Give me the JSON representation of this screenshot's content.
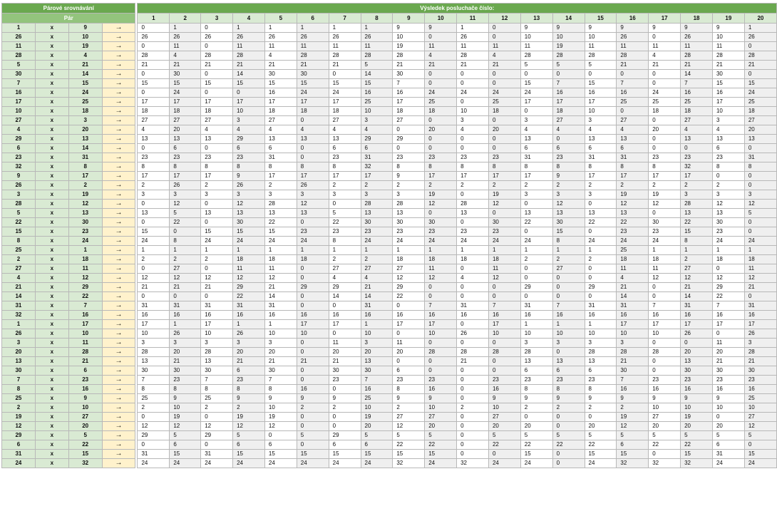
{
  "header": {
    "pair_group": "Párové srovnávání",
    "pair": "Pár",
    "result_group": "Výsledek posluchače číslo:"
  },
  "listeners": [
    "1",
    "2",
    "3",
    "4",
    "5",
    "6",
    "7",
    "8",
    "9",
    "10",
    "11",
    "12",
    "13",
    "14",
    "15",
    "16",
    "17",
    "18",
    "19",
    "20"
  ],
  "rows": [
    {
      "a": "1",
      "b": "9",
      "vals": [
        "0",
        "1",
        "0",
        "1",
        "1",
        "1",
        "1",
        "1",
        "9",
        "9",
        "1",
        "0",
        "9",
        "9",
        "9",
        "9",
        "9",
        "9",
        "9",
        "1"
      ]
    },
    {
      "a": "26",
      "b": "10",
      "vals": [
        "26",
        "26",
        "26",
        "26",
        "26",
        "26",
        "26",
        "26",
        "10",
        "0",
        "26",
        "0",
        "10",
        "10",
        "10",
        "26",
        "0",
        "26",
        "10",
        "26"
      ]
    },
    {
      "a": "11",
      "b": "19",
      "vals": [
        "0",
        "11",
        "0",
        "11",
        "11",
        "11",
        "11",
        "11",
        "19",
        "11",
        "11",
        "11",
        "11",
        "19",
        "11",
        "11",
        "11",
        "11",
        "11",
        "0"
      ]
    },
    {
      "a": "28",
      "b": "4",
      "vals": [
        "28",
        "4",
        "28",
        "28",
        "4",
        "28",
        "28",
        "28",
        "28",
        "4",
        "28",
        "4",
        "28",
        "28",
        "28",
        "28",
        "4",
        "28",
        "28",
        "28"
      ]
    },
    {
      "a": "5",
      "b": "21",
      "vals": [
        "21",
        "21",
        "21",
        "21",
        "21",
        "21",
        "21",
        "5",
        "21",
        "21",
        "21",
        "21",
        "5",
        "5",
        "5",
        "21",
        "21",
        "21",
        "21",
        "21"
      ]
    },
    {
      "a": "30",
      "b": "14",
      "vals": [
        "0",
        "30",
        "0",
        "14",
        "30",
        "30",
        "0",
        "14",
        "30",
        "0",
        "0",
        "0",
        "0",
        "0",
        "0",
        "0",
        "0",
        "14",
        "30",
        "0"
      ]
    },
    {
      "a": "7",
      "b": "15",
      "vals": [
        "15",
        "15",
        "15",
        "15",
        "15",
        "15",
        "15",
        "15",
        "7",
        "0",
        "0",
        "0",
        "15",
        "7",
        "15",
        "7",
        "0",
        "7",
        "15",
        "15"
      ]
    },
    {
      "a": "16",
      "b": "24",
      "vals": [
        "0",
        "24",
        "0",
        "0",
        "16",
        "24",
        "24",
        "16",
        "16",
        "24",
        "24",
        "24",
        "24",
        "16",
        "16",
        "16",
        "24",
        "16",
        "16",
        "24"
      ]
    },
    {
      "a": "17",
      "b": "25",
      "vals": [
        "17",
        "17",
        "17",
        "17",
        "17",
        "17",
        "17",
        "25",
        "17",
        "25",
        "0",
        "25",
        "17",
        "17",
        "17",
        "25",
        "25",
        "25",
        "17",
        "25"
      ]
    },
    {
      "a": "10",
      "b": "18",
      "vals": [
        "18",
        "18",
        "18",
        "10",
        "18",
        "18",
        "18",
        "10",
        "18",
        "18",
        "10",
        "18",
        "0",
        "18",
        "10",
        "0",
        "18",
        "18",
        "10",
        "18"
      ]
    },
    {
      "a": "27",
      "b": "3",
      "vals": [
        "27",
        "27",
        "27",
        "3",
        "27",
        "0",
        "27",
        "3",
        "27",
        "0",
        "3",
        "0",
        "3",
        "27",
        "3",
        "27",
        "0",
        "27",
        "3",
        "27"
      ]
    },
    {
      "a": "4",
      "b": "20",
      "vals": [
        "4",
        "20",
        "4",
        "4",
        "4",
        "4",
        "4",
        "4",
        "0",
        "20",
        "4",
        "20",
        "4",
        "4",
        "4",
        "4",
        "20",
        "4",
        "4",
        "20"
      ]
    },
    {
      "a": "29",
      "b": "13",
      "vals": [
        "13",
        "13",
        "13",
        "29",
        "13",
        "13",
        "13",
        "29",
        "29",
        "0",
        "0",
        "0",
        "13",
        "0",
        "13",
        "13",
        "0",
        "13",
        "13",
        "13"
      ]
    },
    {
      "a": "6",
      "b": "14",
      "vals": [
        "0",
        "6",
        "0",
        "6",
        "6",
        "0",
        "6",
        "6",
        "0",
        "0",
        "0",
        "0",
        "6",
        "6",
        "6",
        "6",
        "0",
        "0",
        "6",
        "0"
      ]
    },
    {
      "a": "23",
      "b": "31",
      "vals": [
        "23",
        "23",
        "23",
        "23",
        "31",
        "0",
        "23",
        "31",
        "23",
        "23",
        "23",
        "23",
        "31",
        "23",
        "31",
        "31",
        "23",
        "23",
        "23",
        "31"
      ]
    },
    {
      "a": "32",
      "b": "8",
      "vals": [
        "8",
        "8",
        "8",
        "8",
        "8",
        "8",
        "8",
        "32",
        "8",
        "8",
        "8",
        "8",
        "8",
        "8",
        "8",
        "8",
        "8",
        "32",
        "8",
        "8"
      ]
    },
    {
      "a": "9",
      "b": "17",
      "vals": [
        "17",
        "17",
        "17",
        "9",
        "17",
        "17",
        "17",
        "17",
        "9",
        "17",
        "17",
        "17",
        "17",
        "9",
        "17",
        "17",
        "17",
        "17",
        "0",
        "0"
      ]
    },
    {
      "a": "26",
      "b": "2",
      "vals": [
        "2",
        "26",
        "2",
        "26",
        "2",
        "26",
        "2",
        "2",
        "2",
        "2",
        "2",
        "2",
        "2",
        "2",
        "2",
        "2",
        "2",
        "2",
        "2",
        "0"
      ]
    },
    {
      "a": "3",
      "b": "19",
      "vals": [
        "3",
        "3",
        "3",
        "3",
        "3",
        "3",
        "3",
        "3",
        "3",
        "19",
        "0",
        "19",
        "3",
        "3",
        "3",
        "19",
        "19",
        "3",
        "3",
        "3"
      ]
    },
    {
      "a": "28",
      "b": "12",
      "vals": [
        "0",
        "12",
        "0",
        "12",
        "28",
        "12",
        "0",
        "28",
        "28",
        "12",
        "28",
        "12",
        "0",
        "12",
        "0",
        "12",
        "12",
        "28",
        "12",
        "12"
      ]
    },
    {
      "a": "5",
      "b": "13",
      "vals": [
        "13",
        "5",
        "13",
        "13",
        "13",
        "13",
        "5",
        "13",
        "13",
        "0",
        "13",
        "0",
        "13",
        "13",
        "13",
        "13",
        "0",
        "13",
        "13",
        "5"
      ]
    },
    {
      "a": "22",
      "b": "30",
      "vals": [
        "0",
        "22",
        "0",
        "30",
        "22",
        "0",
        "22",
        "30",
        "30",
        "30",
        "0",
        "30",
        "22",
        "30",
        "22",
        "22",
        "30",
        "22",
        "30",
        "0"
      ]
    },
    {
      "a": "15",
      "b": "23",
      "vals": [
        "15",
        "0",
        "15",
        "15",
        "15",
        "23",
        "23",
        "23",
        "23",
        "23",
        "23",
        "23",
        "0",
        "15",
        "0",
        "23",
        "23",
        "15",
        "23",
        "0"
      ]
    },
    {
      "a": "8",
      "b": "24",
      "vals": [
        "24",
        "8",
        "24",
        "24",
        "24",
        "24",
        "8",
        "24",
        "24",
        "24",
        "24",
        "24",
        "24",
        "8",
        "24",
        "24",
        "24",
        "8",
        "24",
        "24"
      ]
    },
    {
      "a": "25",
      "b": "1",
      "vals": [
        "1",
        "1",
        "1",
        "1",
        "1",
        "1",
        "1",
        "1",
        "1",
        "1",
        "1",
        "1",
        "1",
        "1",
        "1",
        "25",
        "1",
        "1",
        "1",
        "1"
      ]
    },
    {
      "a": "2",
      "b": "18",
      "vals": [
        "2",
        "2",
        "2",
        "18",
        "18",
        "18",
        "2",
        "2",
        "18",
        "18",
        "18",
        "18",
        "2",
        "2",
        "2",
        "18",
        "18",
        "2",
        "18",
        "18"
      ]
    },
    {
      "a": "27",
      "b": "11",
      "vals": [
        "0",
        "27",
        "0",
        "11",
        "11",
        "0",
        "27",
        "27",
        "27",
        "11",
        "0",
        "11",
        "0",
        "27",
        "0",
        "11",
        "11",
        "27",
        "0",
        "11"
      ]
    },
    {
      "a": "4",
      "b": "12",
      "vals": [
        "12",
        "12",
        "12",
        "12",
        "12",
        "0",
        "4",
        "4",
        "12",
        "12",
        "4",
        "12",
        "0",
        "0",
        "0",
        "4",
        "12",
        "12",
        "12",
        "12"
      ]
    },
    {
      "a": "21",
      "b": "29",
      "vals": [
        "21",
        "21",
        "21",
        "29",
        "21",
        "29",
        "29",
        "21",
        "29",
        "0",
        "0",
        "0",
        "29",
        "0",
        "29",
        "21",
        "0",
        "21",
        "29",
        "21"
      ]
    },
    {
      "a": "14",
      "b": "22",
      "vals": [
        "0",
        "0",
        "0",
        "22",
        "14",
        "0",
        "14",
        "14",
        "22",
        "0",
        "0",
        "0",
        "0",
        "0",
        "0",
        "14",
        "0",
        "14",
        "22",
        "0"
      ]
    },
    {
      "a": "31",
      "b": "7",
      "vals": [
        "31",
        "31",
        "31",
        "31",
        "31",
        "0",
        "0",
        "31",
        "0",
        "7",
        "31",
        "7",
        "31",
        "7",
        "31",
        "31",
        "7",
        "31",
        "7",
        "31"
      ]
    },
    {
      "a": "32",
      "b": "16",
      "vals": [
        "16",
        "16",
        "16",
        "16",
        "16",
        "16",
        "16",
        "16",
        "16",
        "16",
        "16",
        "16",
        "16",
        "16",
        "16",
        "16",
        "16",
        "16",
        "16",
        "16"
      ]
    },
    {
      "a": "1",
      "b": "17",
      "vals": [
        "17",
        "1",
        "17",
        "1",
        "1",
        "17",
        "17",
        "1",
        "17",
        "17",
        "0",
        "17",
        "1",
        "1",
        "1",
        "17",
        "17",
        "17",
        "17",
        "17"
      ]
    },
    {
      "a": "26",
      "b": "10",
      "vals": [
        "10",
        "26",
        "10",
        "26",
        "10",
        "10",
        "0",
        "10",
        "0",
        "10",
        "26",
        "10",
        "10",
        "10",
        "10",
        "10",
        "10",
        "26",
        "0",
        "26"
      ]
    },
    {
      "a": "3",
      "b": "11",
      "vals": [
        "3",
        "3",
        "3",
        "3",
        "3",
        "0",
        "11",
        "3",
        "11",
        "0",
        "0",
        "0",
        "3",
        "3",
        "3",
        "3",
        "0",
        "0",
        "11",
        "3"
      ]
    },
    {
      "a": "20",
      "b": "28",
      "vals": [
        "28",
        "20",
        "28",
        "20",
        "20",
        "0",
        "20",
        "20",
        "20",
        "28",
        "28",
        "28",
        "28",
        "0",
        "28",
        "28",
        "28",
        "20",
        "20",
        "28"
      ]
    },
    {
      "a": "13",
      "b": "21",
      "vals": [
        "13",
        "21",
        "13",
        "21",
        "21",
        "21",
        "21",
        "13",
        "0",
        "0",
        "21",
        "0",
        "13",
        "13",
        "13",
        "21",
        "0",
        "13",
        "21",
        "21"
      ]
    },
    {
      "a": "30",
      "b": "6",
      "vals": [
        "30",
        "30",
        "30",
        "6",
        "30",
        "0",
        "30",
        "30",
        "6",
        "0",
        "0",
        "0",
        "6",
        "6",
        "6",
        "30",
        "0",
        "30",
        "30",
        "30"
      ]
    },
    {
      "a": "7",
      "b": "23",
      "vals": [
        "7",
        "23",
        "7",
        "23",
        "7",
        "0",
        "23",
        "7",
        "23",
        "23",
        "0",
        "23",
        "23",
        "23",
        "23",
        "7",
        "23",
        "23",
        "23",
        "23"
      ]
    },
    {
      "a": "8",
      "b": "16",
      "vals": [
        "8",
        "8",
        "8",
        "8",
        "8",
        "16",
        "0",
        "16",
        "8",
        "16",
        "0",
        "16",
        "8",
        "8",
        "8",
        "16",
        "16",
        "16",
        "16",
        "16"
      ]
    },
    {
      "a": "25",
      "b": "9",
      "vals": [
        "25",
        "9",
        "25",
        "9",
        "9",
        "9",
        "9",
        "25",
        "9",
        "9",
        "0",
        "9",
        "9",
        "9",
        "9",
        "9",
        "9",
        "9",
        "9",
        "25"
      ]
    },
    {
      "a": "2",
      "b": "10",
      "vals": [
        "2",
        "10",
        "2",
        "2",
        "10",
        "2",
        "2",
        "10",
        "2",
        "10",
        "2",
        "10",
        "2",
        "2",
        "2",
        "2",
        "10",
        "10",
        "10",
        "10"
      ]
    },
    {
      "a": "19",
      "b": "27",
      "vals": [
        "0",
        "19",
        "0",
        "19",
        "19",
        "0",
        "0",
        "19",
        "27",
        "27",
        "0",
        "27",
        "0",
        "0",
        "0",
        "19",
        "27",
        "19",
        "0",
        "27"
      ]
    },
    {
      "a": "12",
      "b": "20",
      "vals": [
        "12",
        "12",
        "12",
        "12",
        "12",
        "0",
        "0",
        "20",
        "12",
        "20",
        "0",
        "20",
        "20",
        "0",
        "20",
        "12",
        "20",
        "20",
        "20",
        "12"
      ]
    },
    {
      "a": "29",
      "b": "5",
      "vals": [
        "29",
        "5",
        "29",
        "5",
        "0",
        "5",
        "29",
        "5",
        "5",
        "5",
        "0",
        "5",
        "5",
        "5",
        "5",
        "5",
        "5",
        "5",
        "5",
        "5"
      ]
    },
    {
      "a": "6",
      "b": "22",
      "vals": [
        "0",
        "6",
        "0",
        "6",
        "6",
        "0",
        "6",
        "6",
        "22",
        "22",
        "0",
        "22",
        "22",
        "22",
        "22",
        "6",
        "22",
        "22",
        "6",
        "0"
      ]
    },
    {
      "a": "31",
      "b": "15",
      "vals": [
        "31",
        "15",
        "31",
        "15",
        "15",
        "15",
        "15",
        "15",
        "15",
        "15",
        "0",
        "0",
        "15",
        "0",
        "15",
        "15",
        "0",
        "15",
        "31",
        "15"
      ]
    },
    {
      "a": "24",
      "b": "32",
      "vals": [
        "24",
        "24",
        "24",
        "24",
        "24",
        "24",
        "24",
        "24",
        "32",
        "24",
        "32",
        "24",
        "24",
        "0",
        "24",
        "32",
        "32",
        "32",
        "24",
        "24"
      ]
    }
  ],
  "x_symbol": "x",
  "arrow_symbol": "→"
}
